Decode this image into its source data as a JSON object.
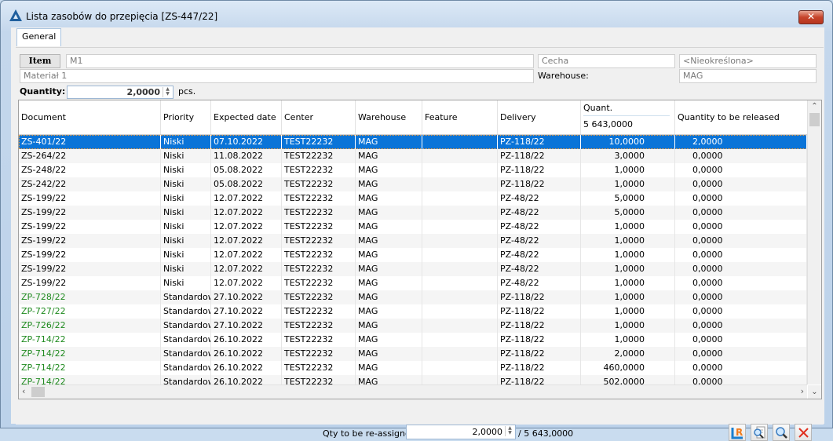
{
  "window": {
    "title": "Lista zasobów do przepięcia [ZS-447/22]",
    "close_label": "✕"
  },
  "tabs": [
    {
      "label": "General"
    }
  ],
  "form": {
    "item_button": "Item",
    "item_code": "M1",
    "item_name": "Materiał 1",
    "feature_label": "Cecha",
    "feature_value": "<Nieokreślona>",
    "warehouse_label": "Warehouse:",
    "warehouse_value": "MAG",
    "quantity_label": "Quantity:",
    "quantity_value": "2,0000",
    "unit": "pcs."
  },
  "table": {
    "headers": {
      "document": "Document",
      "priority": "Priority",
      "expected_date": "Expected date",
      "center": "Center",
      "warehouse": "Warehouse",
      "feature": "Feature",
      "delivery": "Delivery",
      "quant": "Quant.",
      "quant_sum": "5 643,0000",
      "to_release": "Quantity to be released"
    },
    "rows": [
      {
        "document": "ZS-401/22",
        "priority": "Niski",
        "date": "07.10.2022",
        "center": "TEST22232",
        "warehouse": "MAG",
        "feature": "",
        "delivery": "PZ-118/22",
        "quant": "10,0000",
        "release": "2,0000",
        "selected": true,
        "green": false
      },
      {
        "document": "ZS-264/22",
        "priority": "Niski",
        "date": "11.08.2022",
        "center": "TEST22232",
        "warehouse": "MAG",
        "feature": "",
        "delivery": "PZ-118/22",
        "quant": "3,0000",
        "release": "0,0000",
        "selected": false,
        "green": false
      },
      {
        "document": "ZS-248/22",
        "priority": "Niski",
        "date": "05.08.2022",
        "center": "TEST22232",
        "warehouse": "MAG",
        "feature": "",
        "delivery": "PZ-118/22",
        "quant": "1,0000",
        "release": "0,0000",
        "selected": false,
        "green": false
      },
      {
        "document": "ZS-242/22",
        "priority": "Niski",
        "date": "05.08.2022",
        "center": "TEST22232",
        "warehouse": "MAG",
        "feature": "",
        "delivery": "PZ-118/22",
        "quant": "1,0000",
        "release": "0,0000",
        "selected": false,
        "green": false
      },
      {
        "document": "ZS-199/22",
        "priority": "Niski",
        "date": "12.07.2022",
        "center": "TEST22232",
        "warehouse": "MAG",
        "feature": "",
        "delivery": "PZ-48/22",
        "quant": "5,0000",
        "release": "0,0000",
        "selected": false,
        "green": false
      },
      {
        "document": "ZS-199/22",
        "priority": "Niski",
        "date": "12.07.2022",
        "center": "TEST22232",
        "warehouse": "MAG",
        "feature": "",
        "delivery": "PZ-48/22",
        "quant": "5,0000",
        "release": "0,0000",
        "selected": false,
        "green": false
      },
      {
        "document": "ZS-199/22",
        "priority": "Niski",
        "date": "12.07.2022",
        "center": "TEST22232",
        "warehouse": "MAG",
        "feature": "",
        "delivery": "PZ-48/22",
        "quant": "1,0000",
        "release": "0,0000",
        "selected": false,
        "green": false
      },
      {
        "document": "ZS-199/22",
        "priority": "Niski",
        "date": "12.07.2022",
        "center": "TEST22232",
        "warehouse": "MAG",
        "feature": "",
        "delivery": "PZ-48/22",
        "quant": "1,0000",
        "release": "0,0000",
        "selected": false,
        "green": false
      },
      {
        "document": "ZS-199/22",
        "priority": "Niski",
        "date": "12.07.2022",
        "center": "TEST22232",
        "warehouse": "MAG",
        "feature": "",
        "delivery": "PZ-48/22",
        "quant": "1,0000",
        "release": "0,0000",
        "selected": false,
        "green": false
      },
      {
        "document": "ZS-199/22",
        "priority": "Niski",
        "date": "12.07.2022",
        "center": "TEST22232",
        "warehouse": "MAG",
        "feature": "",
        "delivery": "PZ-48/22",
        "quant": "1,0000",
        "release": "0,0000",
        "selected": false,
        "green": false
      },
      {
        "document": "ZS-199/22",
        "priority": "Niski",
        "date": "12.07.2022",
        "center": "TEST22232",
        "warehouse": "MAG",
        "feature": "",
        "delivery": "PZ-48/22",
        "quant": "1,0000",
        "release": "0,0000",
        "selected": false,
        "green": false
      },
      {
        "document": "ZP-728/22",
        "priority": "Standardowy",
        "date": "27.10.2022",
        "center": "TEST22232",
        "warehouse": "MAG",
        "feature": "",
        "delivery": "PZ-118/22",
        "quant": "1,0000",
        "release": "0,0000",
        "selected": false,
        "green": true
      },
      {
        "document": "ZP-727/22",
        "priority": "Standardowy",
        "date": "27.10.2022",
        "center": "TEST22232",
        "warehouse": "MAG",
        "feature": "",
        "delivery": "PZ-118/22",
        "quant": "1,0000",
        "release": "0,0000",
        "selected": false,
        "green": true
      },
      {
        "document": "ZP-726/22",
        "priority": "Standardowy",
        "date": "27.10.2022",
        "center": "TEST22232",
        "warehouse": "MAG",
        "feature": "",
        "delivery": "PZ-118/22",
        "quant": "1,0000",
        "release": "0,0000",
        "selected": false,
        "green": true
      },
      {
        "document": "ZP-714/22",
        "priority": "Standardowy",
        "date": "26.10.2022",
        "center": "TEST22232",
        "warehouse": "MAG",
        "feature": "",
        "delivery": "PZ-118/22",
        "quant": "1,0000",
        "release": "0,0000",
        "selected": false,
        "green": true
      },
      {
        "document": "ZP-714/22",
        "priority": "Standardowy",
        "date": "26.10.2022",
        "center": "TEST22232",
        "warehouse": "MAG",
        "feature": "",
        "delivery": "PZ-118/22",
        "quant": "2,0000",
        "release": "0,0000",
        "selected": false,
        "green": true
      },
      {
        "document": "ZP-714/22",
        "priority": "Standardowy",
        "date": "26.10.2022",
        "center": "TEST22232",
        "warehouse": "MAG",
        "feature": "",
        "delivery": "PZ-118/22",
        "quant": "460,0000",
        "release": "0,0000",
        "selected": false,
        "green": true
      },
      {
        "document": "ZP-714/22",
        "priority": "Standardowy",
        "date": "26.10.2022",
        "center": "TEST22232",
        "warehouse": "MAG",
        "feature": "",
        "delivery": "PZ-118/22",
        "quant": "502,0000",
        "release": "0,0000",
        "selected": false,
        "green": true
      }
    ]
  },
  "footer": {
    "reassign_label": "Qty to be re-assigne",
    "reassign_value": "2,0000",
    "total": "/ 5 643,0000",
    "buttons": [
      "report",
      "preview",
      "search",
      "close"
    ]
  },
  "colors": {
    "selection": "#0a74d8",
    "green_doc": "#1f8a1f",
    "close_red": "#e0301e"
  }
}
